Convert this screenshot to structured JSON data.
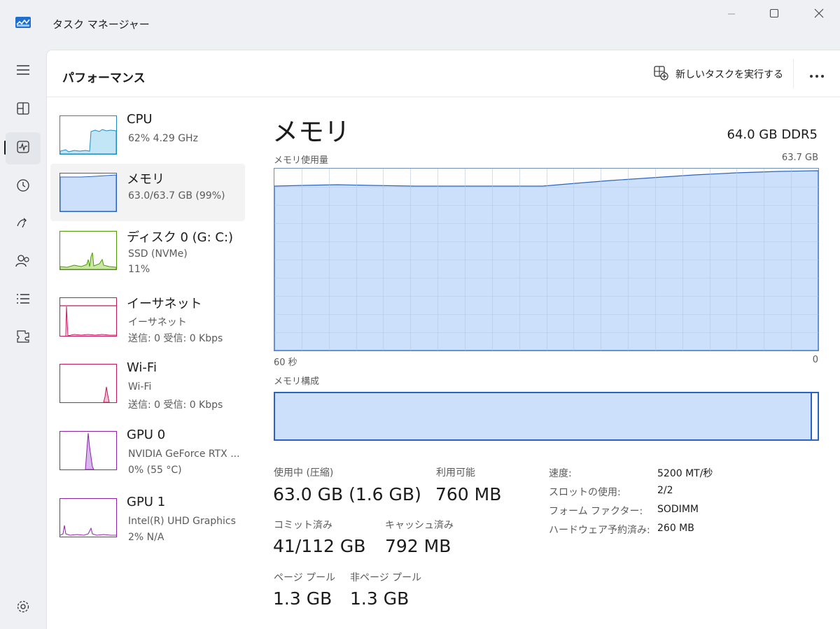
{
  "app": {
    "title": "タスク マネージャー"
  },
  "header": {
    "page_title": "パフォーマンス",
    "new_task_label": "新しいタスクを実行する"
  },
  "devices": [
    {
      "name": "CPU",
      "line1": "62%  4.29 GHz",
      "line2": ""
    },
    {
      "name": "メモリ",
      "line1": "63.0/63.7 GB (99%)",
      "line2": ""
    },
    {
      "name": "ディスク 0 (G: C:)",
      "line1": "SSD (NVMe)",
      "line2": "11%"
    },
    {
      "name": "イーサネット",
      "line1": "イーサネット",
      "line2": "送信: 0  受信: 0 Kbps"
    },
    {
      "name": "Wi-Fi",
      "line1": "Wi-Fi",
      "line2": "送信: 0  受信: 0 Kbps"
    },
    {
      "name": "GPU 0",
      "line1": "NVIDIA GeForce RTX ...",
      "line2": "0%  (55 °C)"
    },
    {
      "name": "GPU 1",
      "line1": "Intel(R) UHD Graphics",
      "line2": "2%  N/A"
    }
  ],
  "memory": {
    "title": "メモリ",
    "spec": "64.0 GB DDR5",
    "usage_label": "メモリ使用量",
    "max_label": "63.7 GB",
    "time_left": "60 秒",
    "time_right": "0",
    "composition_label": "メモリ構成",
    "composition_in_use_fraction": 0.99,
    "stats": {
      "in_use_label": "使用中 (圧縮)",
      "in_use_value": "63.0 GB (1.6 GB)",
      "available_label": "利用可能",
      "available_value": "760 MB",
      "committed_label": "コミット済み",
      "committed_value": "41/112 GB",
      "cached_label": "キャッシュ済み",
      "cached_value": "792 MB",
      "paged_label": "ページ プール",
      "paged_value": "1.3 GB",
      "nonpaged_label": "非ページ プール",
      "nonpaged_value": "1.3 GB"
    },
    "specs": [
      {
        "key": "速度:",
        "value": "5200 MT/秒"
      },
      {
        "key": "スロットの使用:",
        "value": "2/2"
      },
      {
        "key": "フォーム ファクター:",
        "value": "SODIMM"
      },
      {
        "key": "ハードウェア予約済み:",
        "value": "260 MB"
      }
    ]
  },
  "colors": {
    "memory_fill": "#cce0fb",
    "memory_line": "#2b63c2",
    "cpu_fill": "#c2e6f5",
    "cpu_line": "#1e8bc3",
    "disk_fill": "#c9e7a5",
    "disk_line": "#4e9a06",
    "network_line": "#c2185b",
    "gpu_fill": "#d7b7ec",
    "gpu_line": "#8e24aa"
  },
  "icons": [
    "app-icon",
    "minimize-icon",
    "maximize-icon",
    "close-icon",
    "hamburger-icon",
    "processes-icon",
    "performance-icon",
    "app-history-icon",
    "startup-apps-icon",
    "users-icon",
    "details-icon",
    "services-icon",
    "settings-icon",
    "run-new-task-icon",
    "more-icon"
  ]
}
